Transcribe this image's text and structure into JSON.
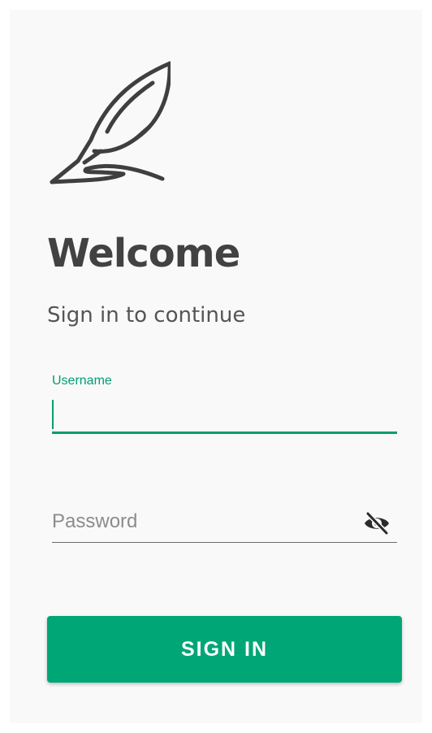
{
  "icons": {
    "logo": "feather-quill-icon",
    "password_toggle": "eye-off-icon"
  },
  "colors": {
    "accent": "#00a676",
    "background": "#f9f9f9",
    "text_dark": "#424242"
  },
  "header": {
    "title": "Welcome",
    "subtitle": "Sign in to continue"
  },
  "form": {
    "username": {
      "label": "Username",
      "value": ""
    },
    "password": {
      "placeholder": "Password",
      "value": ""
    },
    "submit_label": "SIGN IN"
  }
}
